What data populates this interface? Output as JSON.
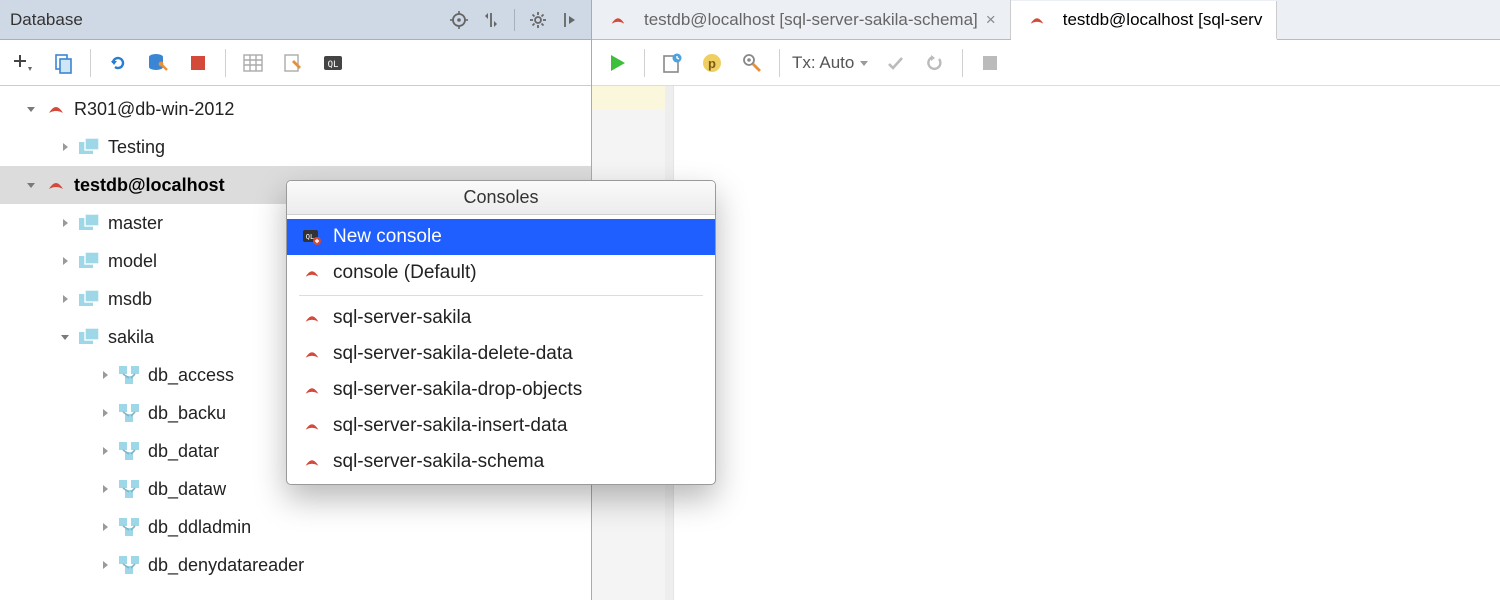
{
  "database_panel": {
    "title": "Database",
    "toolbar": {
      "add": "Add",
      "duplicate": "Duplicate",
      "refresh": "Refresh",
      "sync": "Synchronize",
      "stop": "Stop",
      "table": "Table",
      "edit": "Edit Data",
      "console": "Open Console"
    }
  },
  "tree": {
    "ds1": {
      "label": "R301@db-win-2012"
    },
    "ds1_child": {
      "label": "Testing"
    },
    "ds2": {
      "label": "testdb@localhost"
    },
    "ds2_children": {
      "master": "master",
      "model": "model",
      "msdb": "msdb",
      "sakila": "sakila"
    },
    "sakila_children": {
      "a": "db_access",
      "b": "db_backu",
      "c": "db_datar",
      "d": "db_dataw",
      "e": "db_ddladmin",
      "f": "db_denydatareader"
    }
  },
  "editor": {
    "tabs": {
      "t1": "testdb@localhost [sql-server-sakila-schema]",
      "t2": "testdb@localhost [sql-serv"
    },
    "tx_label": "Tx: Auto"
  },
  "popup": {
    "title": "Consoles",
    "items": {
      "new_console": "New console",
      "default": "console (Default)",
      "c1": "sql-server-sakila",
      "c2": "sql-server-sakila-delete-data",
      "c3": "sql-server-sakila-drop-objects",
      "c4": "sql-server-sakila-insert-data",
      "c5": "sql-server-sakila-schema"
    }
  }
}
